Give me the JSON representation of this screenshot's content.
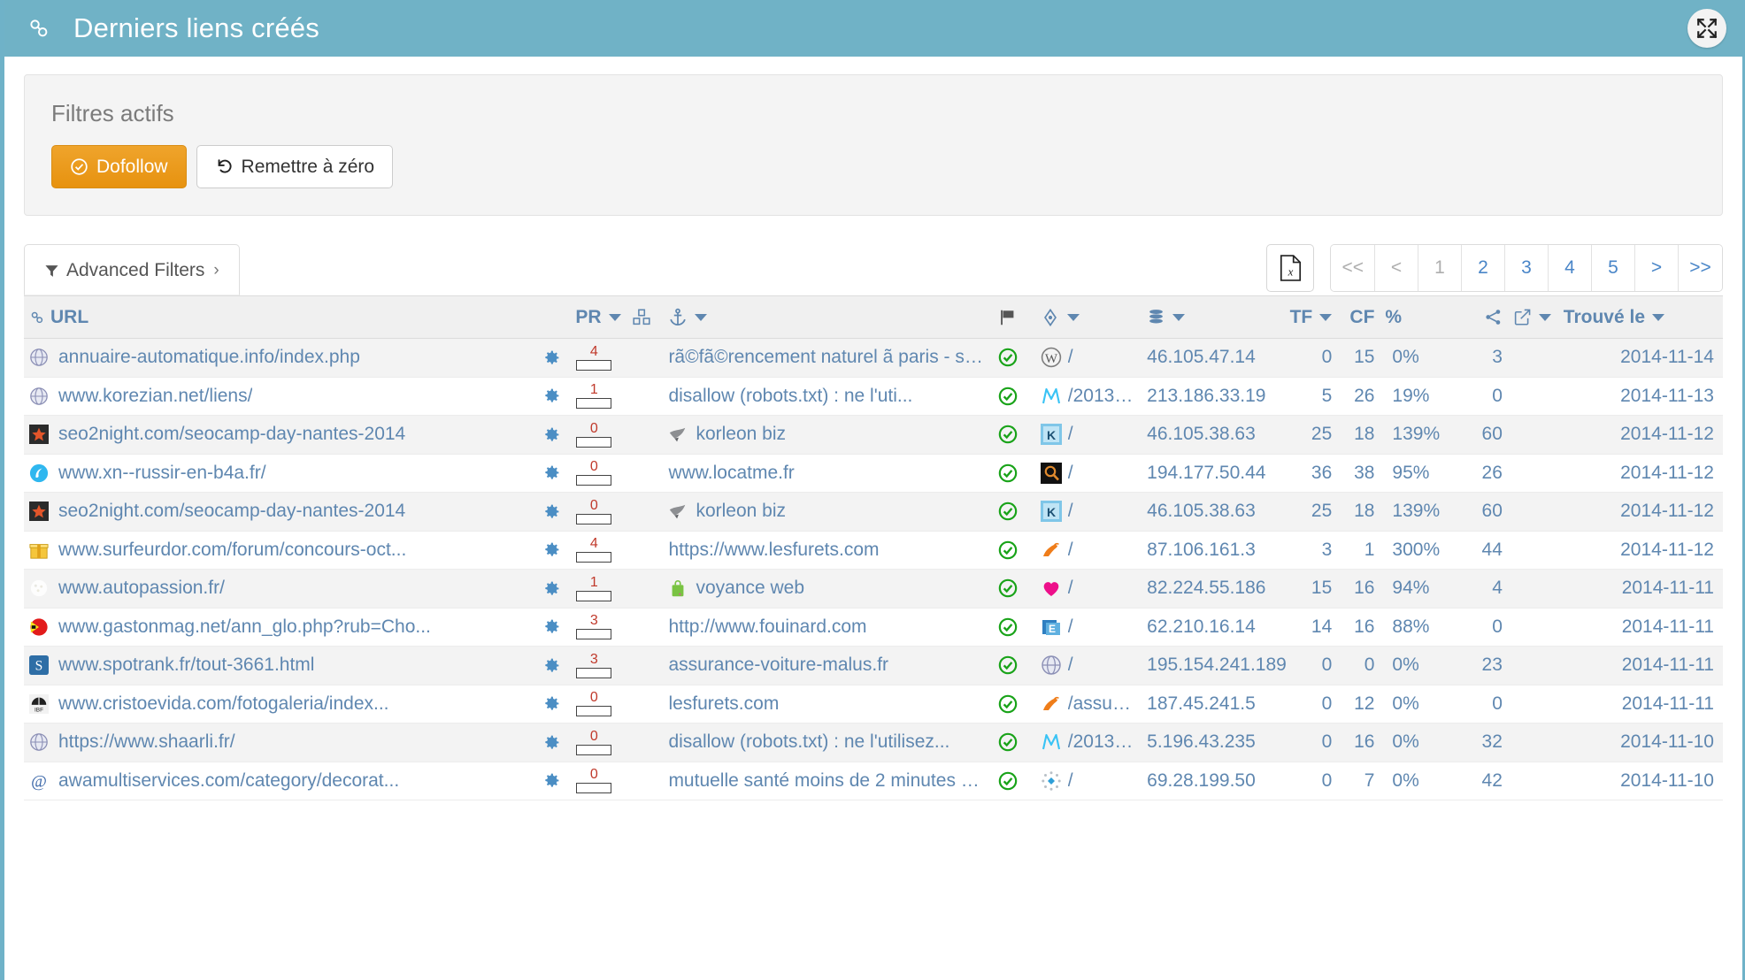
{
  "header": {
    "title": "Derniers liens créés",
    "link_icon": "chain-icon",
    "expand_icon": "expand-arrows-icon",
    "bg_color": "#70b2c6"
  },
  "filters": {
    "heading": "Filtres actifs",
    "dofollow_label": "Dofollow",
    "dofollow_icon": "check-circle-icon",
    "dofollow_color": "#eb9b21",
    "reset_label": "Remettre à zéro",
    "reset_icon": "undo-icon"
  },
  "toolbar": {
    "advanced_filters_label": "Advanced Filters",
    "advanced_filters_chevron": "›",
    "funnel_icon": "filter-funnel-icon",
    "export_icon": "excel-file-icon"
  },
  "pagination": {
    "pages": [
      {
        "label": "<<",
        "active": false,
        "muted": true
      },
      {
        "label": "<",
        "active": false,
        "muted": true
      },
      {
        "label": "1",
        "active": true,
        "muted": true
      },
      {
        "label": "2",
        "active": false,
        "muted": false
      },
      {
        "label": "3",
        "active": false,
        "muted": false
      },
      {
        "label": "4",
        "active": false,
        "muted": false
      },
      {
        "label": "5",
        "active": false,
        "muted": false
      },
      {
        "label": ">",
        "active": false,
        "muted": false
      },
      {
        "label": ">>",
        "active": false,
        "muted": false
      }
    ]
  },
  "table": {
    "columns": [
      {
        "key": "url",
        "label": "URL",
        "icon": "chain-icon",
        "sortable": false
      },
      {
        "key": "gear",
        "label": "",
        "icon": "",
        "sortable": false
      },
      {
        "key": "pr",
        "label": "PR",
        "icon": "",
        "sortable": true
      },
      {
        "key": "cubes",
        "label": "",
        "icon": "cubes-icon",
        "sortable": false
      },
      {
        "key": "anchor",
        "label": "",
        "icon": "anchor-icon",
        "sortable": true
      },
      {
        "key": "flag",
        "label": "",
        "icon": "flag-icon",
        "sortable": false
      },
      {
        "key": "cms",
        "label": "",
        "icon": "move-diamond-icon",
        "sortable": true
      },
      {
        "key": "ip",
        "label": "",
        "icon": "database-icon",
        "sortable": true
      },
      {
        "key": "tf",
        "label": "TF",
        "icon": "",
        "sortable": true
      },
      {
        "key": "cf",
        "label": "CF",
        "icon": "",
        "sortable": false
      },
      {
        "key": "pct",
        "label": "%",
        "icon": "",
        "sortable": false
      },
      {
        "key": "share",
        "label": "",
        "icon": "share-icon",
        "sortable": false
      },
      {
        "key": "ext",
        "label": "",
        "icon": "external-link-icon",
        "sortable": true
      },
      {
        "key": "found",
        "label": "Trouvé le",
        "icon": "",
        "sortable": true
      }
    ],
    "rows": [
      {
        "favicon": "globe-grey-icon",
        "url": "annuaire-automatique.info/index.php",
        "pr": "4",
        "pr_fill": 44,
        "anchor_icon": "",
        "anchor": "rã©fã©rencement naturel ã  paris - se...",
        "status": "check-circle-green-icon",
        "cms_icon": "wordpress-icon",
        "cms_path": "/",
        "ip": "46.105.47.14",
        "tf": "0",
        "cf": "15",
        "pct": "0%",
        "share": "3",
        "found": "2014-11-14"
      },
      {
        "favicon": "globe-grey-icon",
        "url": "www.korezian.net/liens/",
        "pr": "1",
        "pr_fill": 14,
        "anchor_icon": "",
        "anchor": "disallow (robots.txt) : ne l'uti...",
        "status": "check-circle-green-icon",
        "cms_icon": "movable-type-icon",
        "cms_path": "/2013/0...",
        "ip": "213.186.33.19",
        "tf": "5",
        "cf": "26",
        "pct": "19%",
        "share": "0",
        "found": "2014-11-13"
      },
      {
        "favicon": "star-dark-icon",
        "url": "seo2night.com/seocamp-day-nantes-2014",
        "pr": "0",
        "pr_fill": 0,
        "anchor_icon": "bird-grey-icon",
        "anchor": "korleon biz",
        "status": "check-circle-green-icon",
        "cms_icon": "blue-k-icon",
        "cms_path": "/",
        "ip": "46.105.38.63",
        "tf": "25",
        "cf": "18",
        "pct": "139%",
        "share": "60",
        "found": "2014-11-12"
      },
      {
        "favicon": "blue-swirl-icon",
        "url": "www.xn--russir-en-b4a.fr/",
        "pr": "0",
        "pr_fill": 0,
        "anchor_icon": "",
        "anchor": "www.locatme.fr",
        "status": "check-circle-green-icon",
        "cms_icon": "magnifier-dark-icon",
        "cms_path": "/",
        "ip": "194.177.50.44",
        "tf": "36",
        "cf": "38",
        "pct": "95%",
        "share": "26",
        "found": "2014-11-12"
      },
      {
        "favicon": "star-dark-icon",
        "url": "seo2night.com/seocamp-day-nantes-2014",
        "pr": "0",
        "pr_fill": 0,
        "anchor_icon": "bird-grey-icon",
        "anchor": "korleon biz",
        "status": "check-circle-green-icon",
        "cms_icon": "blue-k-icon",
        "cms_path": "/",
        "ip": "46.105.38.63",
        "tf": "25",
        "cf": "18",
        "pct": "139%",
        "share": "60",
        "found": "2014-11-12"
      },
      {
        "favicon": "gold-gift-icon",
        "url": "www.surfeurdor.com/forum/concours-oct...",
        "pr": "4",
        "pr_fill": 44,
        "anchor_icon": "",
        "anchor": "https://www.lesfurets.com",
        "status": "check-circle-green-icon",
        "cms_icon": "orange-ferret-icon",
        "cms_path": "/",
        "ip": "87.106.161.3",
        "tf": "3",
        "cf": "1",
        "pct": "300%",
        "share": "44",
        "found": "2014-11-12"
      },
      {
        "favicon": "pale-dots-icon",
        "url": "www.autopassion.fr/",
        "pr": "1",
        "pr_fill": 14,
        "anchor_icon": "green-bag-icon",
        "anchor": "voyance web",
        "status": "check-circle-green-icon",
        "cms_icon": "pink-heart-icon",
        "cms_path": "/",
        "ip": "82.224.55.186",
        "tf": "15",
        "cf": "16",
        "pct": "94%",
        "share": "4",
        "found": "2014-11-11"
      },
      {
        "favicon": "red-pacman-icon",
        "url": "www.gastonmag.net/ann_glo.php?rub=Cho...",
        "pr": "3",
        "pr_fill": 33,
        "anchor_icon": "",
        "anchor": "http://www.fouinard.com",
        "status": "check-circle-green-icon",
        "cms_icon": "blue-card-icon",
        "cms_path": "/",
        "ip": "62.210.16.14",
        "tf": "14",
        "cf": "16",
        "pct": "88%",
        "share": "0",
        "found": "2014-11-11"
      },
      {
        "favicon": "blue-s-icon",
        "url": "www.spotrank.fr/tout-3661.html",
        "pr": "3",
        "pr_fill": 33,
        "anchor_icon": "",
        "anchor": "assurance-voiture-malus.fr",
        "status": "check-circle-green-icon",
        "cms_icon": "globe-grey-icon",
        "cms_path": "/",
        "ip": "195.154.241.189",
        "tf": "0",
        "cf": "0",
        "pct": "0%",
        "share": "23",
        "found": "2014-11-11"
      },
      {
        "favicon": "ibf-logo-icon",
        "url": "www.cristoevida.com/fotogaleria/index...",
        "pr": "0",
        "pr_fill": 0,
        "anchor_icon": "",
        "anchor": "lesfurets.com",
        "status": "check-circle-green-icon",
        "cms_icon": "orange-ferret-icon",
        "cms_path": "/assura...",
        "ip": "187.45.241.5",
        "tf": "0",
        "cf": "12",
        "pct": "0%",
        "share": "0",
        "found": "2014-11-11"
      },
      {
        "favicon": "globe-grey-icon",
        "url": "https://www.shaarli.fr/",
        "pr": "0",
        "pr_fill": 0,
        "anchor_icon": "",
        "anchor": "disallow (robots.txt) : ne l'utilisez...",
        "status": "check-circle-green-icon",
        "cms_icon": "movable-type-icon",
        "cms_path": "/2013/0...",
        "ip": "5.196.43.235",
        "tf": "0",
        "cf": "16",
        "pct": "0%",
        "share": "32",
        "found": "2014-11-10"
      },
      {
        "favicon": "at-sign-icon",
        "url": "awamultiservices.com/category/decorat...",
        "pr": "0",
        "pr_fill": 0,
        "anchor_icon": "",
        "anchor": "mutuelle santé moins de 2 minutes pou...",
        "status": "check-circle-green-icon",
        "cms_icon": "spinner-diamond-icon",
        "cms_path": "/",
        "ip": "69.28.199.50",
        "tf": "0",
        "cf": "7",
        "pct": "0%",
        "share": "42",
        "found": "2014-11-10"
      }
    ]
  }
}
